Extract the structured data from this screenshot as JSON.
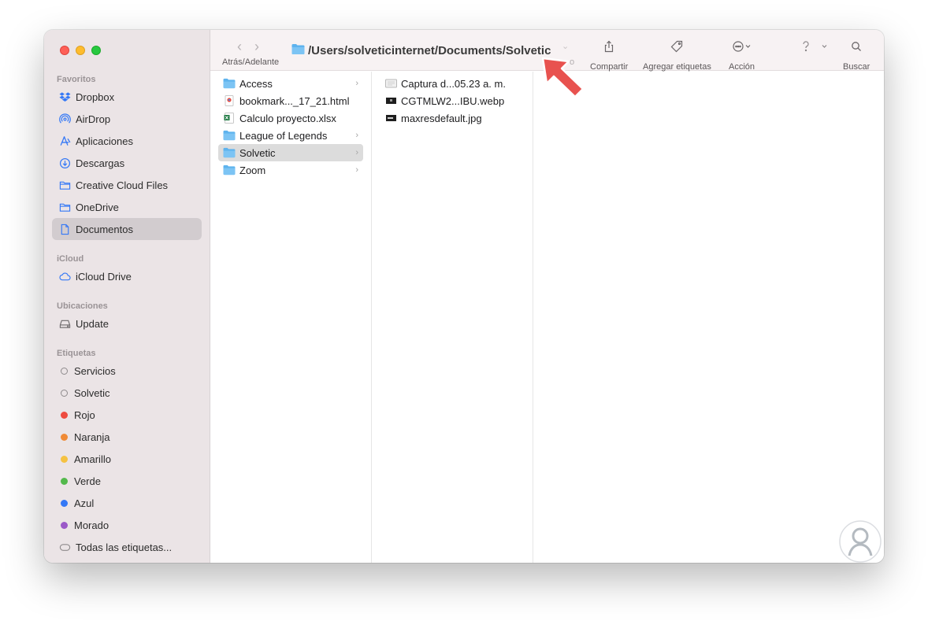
{
  "window": {
    "path_title": "/Users/solveticinternet/Documents/Solvetic",
    "traffic_lights": {
      "close": "#fe5f57",
      "minimize": "#febc2e",
      "zoom": "#28c840"
    }
  },
  "toolbar": {
    "back_icon": "chevron-left-icon",
    "forward_icon": "chevron-right-icon",
    "nav_label": "Atrás/Adelante",
    "partial_label": "o",
    "share_label": "Compartir",
    "tags_label": "Agregar etiquetas",
    "action_label": "Acción",
    "search_label": "Buscar"
  },
  "sidebar": {
    "favorites_title": "Favoritos",
    "favorites": [
      {
        "label": "Dropbox",
        "icon": "dropbox-icon"
      },
      {
        "label": "AirDrop",
        "icon": "airdrop-icon"
      },
      {
        "label": "Aplicaciones",
        "icon": "applications-icon"
      },
      {
        "label": "Descargas",
        "icon": "download-icon"
      },
      {
        "label": "Creative Cloud Files",
        "icon": "folder-icon"
      },
      {
        "label": "OneDrive",
        "icon": "folder-icon"
      },
      {
        "label": "Documentos",
        "icon": "document-icon",
        "selected": true
      }
    ],
    "icloud_title": "iCloud",
    "icloud": [
      {
        "label": "iCloud Drive",
        "icon": "cloud-icon"
      }
    ],
    "locations_title": "Ubicaciones",
    "locations": [
      {
        "label": "Update",
        "icon": "drive-icon"
      }
    ],
    "tags_title": "Etiquetas",
    "tags": [
      {
        "label": "Servicios",
        "color": "hollow"
      },
      {
        "label": "Solvetic",
        "color": "hollow"
      },
      {
        "label": "Rojo",
        "color": "#ee4b40"
      },
      {
        "label": "Naranja",
        "color": "#f08a36"
      },
      {
        "label": "Amarillo",
        "color": "#f5c242"
      },
      {
        "label": "Verde",
        "color": "#53b94c"
      },
      {
        "label": "Azul",
        "color": "#3478f6"
      },
      {
        "label": "Morado",
        "color": "#9b59c8"
      }
    ],
    "all_tags_label": "Todas las etiquetas..."
  },
  "column1": [
    {
      "label": "Access",
      "icon": "folder-icon",
      "chevron": true
    },
    {
      "label": "bookmark..._17_21.html",
      "icon": "chrome-html-icon",
      "chevron": false
    },
    {
      "label": "Calculo proyecto.xlsx",
      "icon": "excel-icon",
      "chevron": false
    },
    {
      "label": "League of Legends",
      "icon": "folder-icon",
      "chevron": true
    },
    {
      "label": "Solvetic",
      "icon": "folder-icon",
      "chevron": true,
      "selected": true
    },
    {
      "label": "Zoom",
      "icon": "folder-icon",
      "chevron": true
    }
  ],
  "column2": [
    {
      "label": "Captura d...05.23 a. m.",
      "icon": "screenshot-icon"
    },
    {
      "label": "CGTMLW2...IBU.webp",
      "icon": "image-icon"
    },
    {
      "label": "maxresdefault.jpg",
      "icon": "image-icon"
    }
  ],
  "colors": {
    "accent": "#3478f6",
    "folder": "#5eb3ee",
    "annotation_arrow": "#e8524f"
  }
}
